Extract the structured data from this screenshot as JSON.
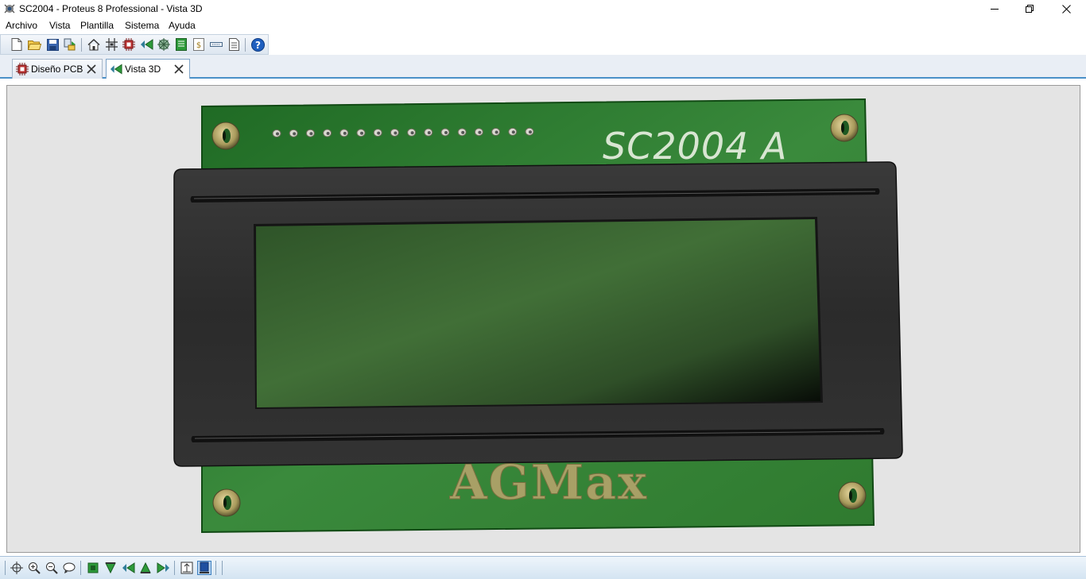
{
  "window": {
    "title": "SC2004 - Proteus 8 Professional - Vista 3D",
    "icon": "proteus-app-icon"
  },
  "menu": {
    "items": [
      "Archivo",
      "Vista",
      "Plantilla",
      "Sistema",
      "Ayuda"
    ]
  },
  "toolbar": {
    "buttons": [
      {
        "icon": "new-file-icon"
      },
      {
        "icon": "open-folder-icon"
      },
      {
        "icon": "save-icon"
      },
      {
        "icon": "import-export-icon"
      },
      {
        "icon": "home-icon"
      },
      {
        "icon": "schematic-icon"
      },
      {
        "icon": "pcb-layout-icon"
      },
      {
        "icon": "3d-view-icon"
      },
      {
        "icon": "gerber-viewer-icon"
      },
      {
        "icon": "bill-of-materials-icon"
      },
      {
        "icon": "source-code-icon"
      },
      {
        "icon": "design-notes-icon"
      },
      {
        "icon": "help-icon"
      }
    ]
  },
  "tabs": [
    {
      "label": "Diseño PCB",
      "icon": "pcb-layout-icon",
      "active": false
    },
    {
      "label": "Vista 3D",
      "icon": "3d-view-icon",
      "active": true
    }
  ],
  "board": {
    "silkscreen_title": "SC2004 A",
    "logo_text": "AGMax",
    "pcb_color": "#2f7d2f",
    "bezel_color": "#2a2a2a",
    "screen_color": "#3d6a33"
  },
  "bottom_toolbar": {
    "buttons": [
      {
        "icon": "pan-icon"
      },
      {
        "icon": "zoom-in-icon"
      },
      {
        "icon": "zoom-out-icon"
      },
      {
        "icon": "orbit-icon"
      },
      {
        "icon": "view-top-icon"
      },
      {
        "icon": "view-front-icon"
      },
      {
        "icon": "view-left-icon"
      },
      {
        "icon": "view-back-icon"
      },
      {
        "icon": "view-right-icon"
      },
      {
        "icon": "height-toggle-icon"
      },
      {
        "icon": "component-toggle-icon",
        "pressed": true
      }
    ]
  }
}
